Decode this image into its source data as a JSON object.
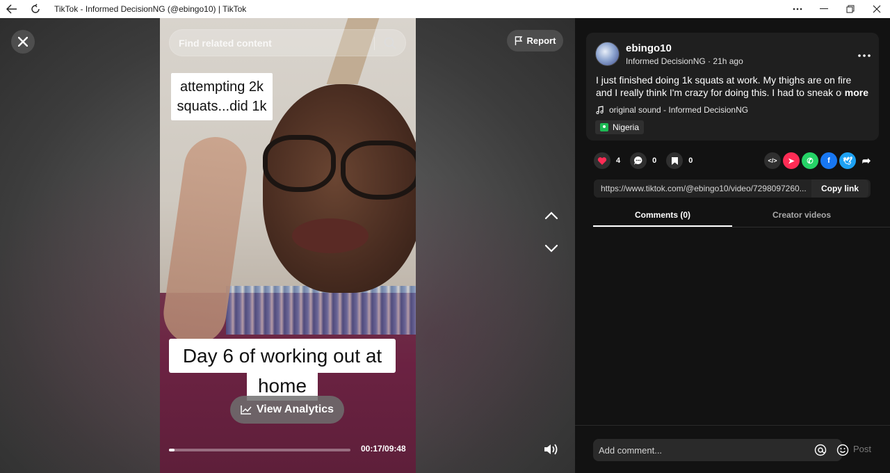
{
  "window": {
    "title": "TikTok - Informed DecisionNG (@ebingo10) | TikTok"
  },
  "video": {
    "search_placeholder": "Find related content",
    "report_label": "Report",
    "caption_top": "attempting 2k squats...did 1k",
    "caption_bottom_line1": "Day 6 of working out at",
    "caption_bottom_line2": "home",
    "analytics_label": "View Analytics",
    "time": "00:17/09:48",
    "progress_fraction": 0.029
  },
  "post": {
    "username": "ebingo10",
    "display_name": "Informed DecisionNG",
    "posted": "21h ago",
    "separator": " · ",
    "description": "I just finished doing 1k squats at work. My thighs are on fire and I really think I'm crazy for doing this. I had to sneak out ...",
    "more_label": "more",
    "sound": "original sound - Informed DecisionNG",
    "location": "Nigeria",
    "likes": "4",
    "comments": "0",
    "saves": "0",
    "link": "https://www.tiktok.com/@ebingo10/video/7298097260...",
    "copy_label": "Copy link"
  },
  "share_icons": [
    {
      "name": "embed-icon",
      "color": "#2f2f2f",
      "glyph": "</>"
    },
    {
      "name": "send-icon",
      "color": "#fe2c55",
      "glyph": "➤"
    },
    {
      "name": "whatsapp-icon",
      "color": "#25d366",
      "glyph": "✆"
    },
    {
      "name": "facebook-icon",
      "color": "#1877f2",
      "glyph": "f"
    },
    {
      "name": "twitter-icon",
      "color": "#1da1f2",
      "glyph": "🕊"
    },
    {
      "name": "share-arrow-icon",
      "color": "transparent",
      "glyph": "➦"
    }
  ],
  "tabs": {
    "comments": "Comments (0)",
    "creator_videos": "Creator videos"
  },
  "comment_bar": {
    "placeholder": "Add comment...",
    "post_label": "Post"
  },
  "colors": {
    "accent": "#fe2c55",
    "panel_bg": "#121212",
    "card_bg": "#1f1f1f"
  }
}
